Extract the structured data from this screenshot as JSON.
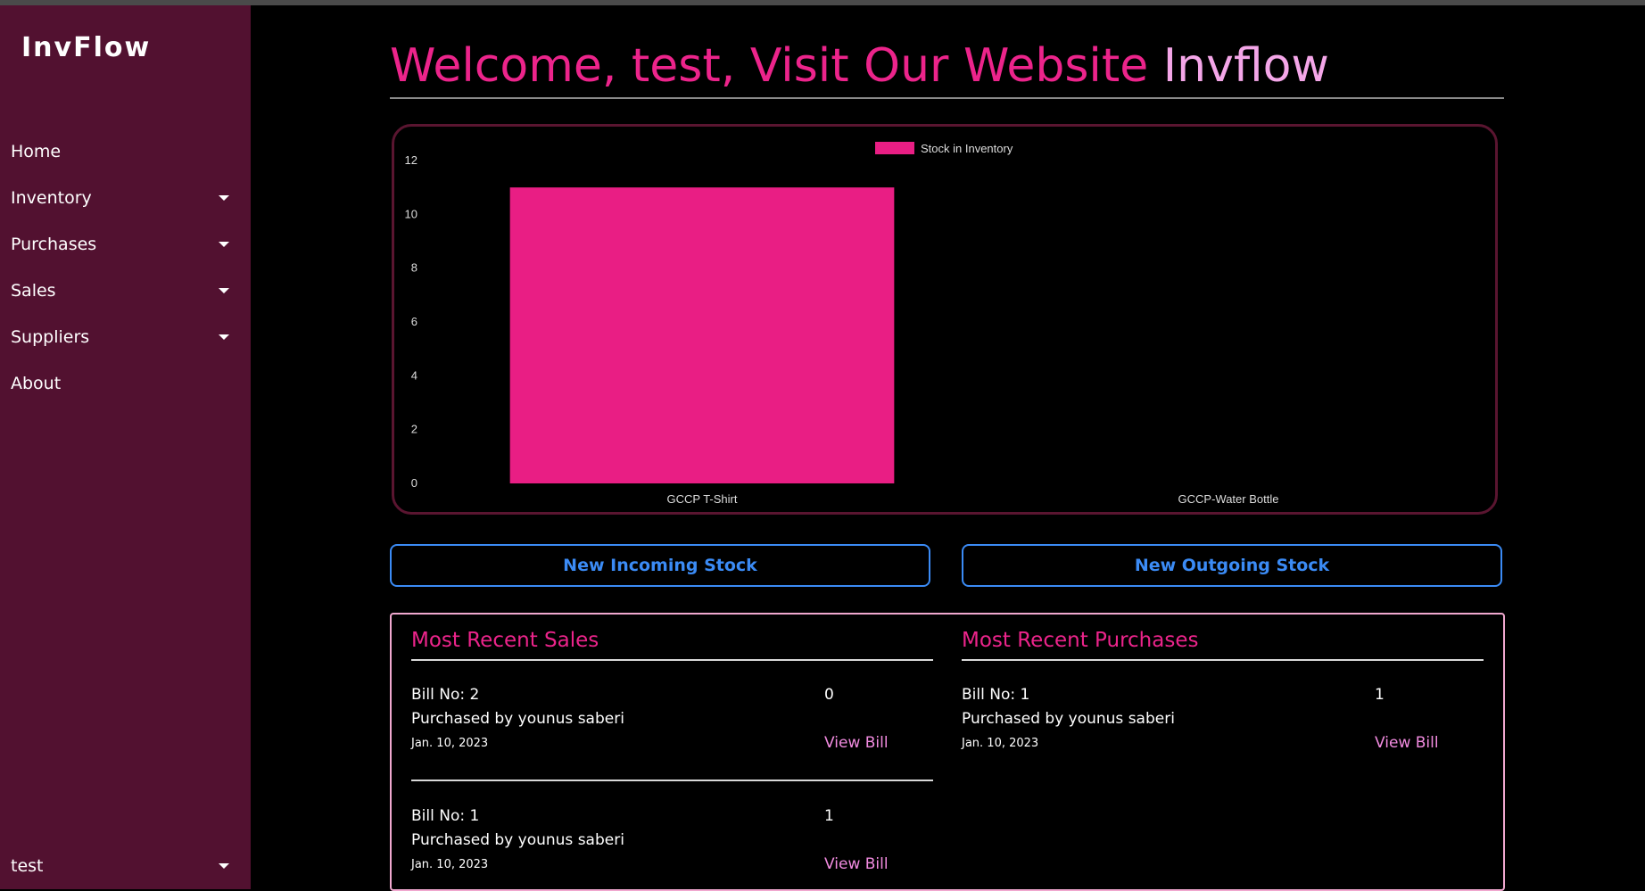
{
  "app": {
    "logo": "InvFlow"
  },
  "sidebar": {
    "items": [
      {
        "label": "Home",
        "dropdown": false
      },
      {
        "label": "Inventory",
        "dropdown": true
      },
      {
        "label": "Purchases",
        "dropdown": true
      },
      {
        "label": "Sales",
        "dropdown": true
      },
      {
        "label": "Suppliers",
        "dropdown": true
      },
      {
        "label": "About",
        "dropdown": false
      }
    ],
    "user": "test"
  },
  "header": {
    "welcome_prefix": "Welcome, test, Visit Our Website ",
    "brand": "Invflow"
  },
  "colors": {
    "sidebar_bg": "#521130",
    "accent_pink": "#ec248b",
    "light_pink": "#f4a6e8",
    "button_blue": "#3b8bf5",
    "chart_border": "#5a1530"
  },
  "chart_data": {
    "type": "bar",
    "categories": [
      "GCCP T-Shirt",
      "GCCP-Water Bottle"
    ],
    "series": [
      {
        "name": "Stock in Inventory",
        "values": [
          11,
          0
        ],
        "color": "#e91e84"
      }
    ],
    "ylim": [
      0,
      12
    ],
    "yticks": [
      0,
      2,
      4,
      6,
      8,
      10,
      12
    ],
    "legend": "top-center",
    "grid": false
  },
  "actions": {
    "incoming": "New Incoming Stock",
    "outgoing": "New Outgoing Stock"
  },
  "sales": {
    "title": "Most Recent Sales",
    "entries": [
      {
        "bill": "Bill No: 2",
        "by": "Purchased by younus saberi",
        "date": "Jan. 10, 2023",
        "amount": "0",
        "view": "View Bill"
      },
      {
        "bill": "Bill No: 1",
        "by": "Purchased by younus saberi",
        "date": "Jan. 10, 2023",
        "amount": "1",
        "view": "View Bill"
      }
    ]
  },
  "purchases": {
    "title": "Most Recent Purchases",
    "entries": [
      {
        "bill": "Bill No: 1",
        "by": "Purchased by younus saberi",
        "date": "Jan. 10, 2023",
        "amount": "1",
        "view": "View Bill"
      }
    ]
  }
}
